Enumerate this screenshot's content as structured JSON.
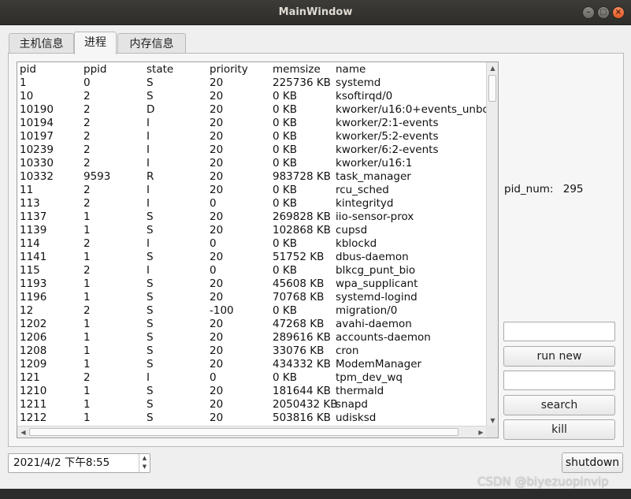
{
  "window": {
    "title": "MainWindow"
  },
  "tabs": [
    {
      "label": "主机信息"
    },
    {
      "label": "进程"
    },
    {
      "label": "内存信息"
    }
  ],
  "process_table": {
    "headers": [
      "pid",
      "ppid",
      "state",
      "priority",
      "memsize",
      "name"
    ],
    "rows": [
      [
        "1",
        "0",
        "S",
        "20",
        "225736 KB",
        "systemd"
      ],
      [
        "10",
        "2",
        "S",
        "20",
        "0 KB",
        "ksoftirqd/0"
      ],
      [
        "10190",
        "2",
        "D",
        "20",
        "0 KB",
        "kworker/u16:0+events_unbo"
      ],
      [
        "10194",
        "2",
        "I",
        "20",
        "0 KB",
        "kworker/2:1-events"
      ],
      [
        "10197",
        "2",
        "I",
        "20",
        "0 KB",
        "kworker/5:2-events"
      ],
      [
        "10239",
        "2",
        "I",
        "20",
        "0 KB",
        "kworker/6:2-events"
      ],
      [
        "10330",
        "2",
        "I",
        "20",
        "0 KB",
        "kworker/u16:1"
      ],
      [
        "10332",
        "9593",
        "R",
        "20",
        "983728 KB",
        "task_manager"
      ],
      [
        "11",
        "2",
        "I",
        "20",
        "0 KB",
        "rcu_sched"
      ],
      [
        "113",
        "2",
        "I",
        "0",
        "0 KB",
        "kintegrityd"
      ],
      [
        "1137",
        "1",
        "S",
        "20",
        "269828 KB",
        "iio-sensor-prox"
      ],
      [
        "1139",
        "1",
        "S",
        "20",
        "102868 KB",
        "cupsd"
      ],
      [
        "114",
        "2",
        "I",
        "0",
        "0 KB",
        "kblockd"
      ],
      [
        "1141",
        "1",
        "S",
        "20",
        "51752 KB",
        "dbus-daemon"
      ],
      [
        "115",
        "2",
        "I",
        "0",
        "0 KB",
        "blkcg_punt_bio"
      ],
      [
        "1193",
        "1",
        "S",
        "20",
        "45608 KB",
        "wpa_supplicant"
      ],
      [
        "1196",
        "1",
        "S",
        "20",
        "70768 KB",
        "systemd-logind"
      ],
      [
        "12",
        "2",
        "S",
        "-100",
        "0 KB",
        "migration/0"
      ],
      [
        "1202",
        "1",
        "S",
        "20",
        "47268 KB",
        "avahi-daemon"
      ],
      [
        "1206",
        "1",
        "S",
        "20",
        "289616 KB",
        "accounts-daemon"
      ],
      [
        "1208",
        "1",
        "S",
        "20",
        "33076 KB",
        "cron"
      ],
      [
        "1209",
        "1",
        "S",
        "20",
        "434332 KB",
        "ModemManager"
      ],
      [
        "121",
        "2",
        "I",
        "0",
        "0 KB",
        "tpm_dev_wq"
      ],
      [
        "1210",
        "1",
        "S",
        "20",
        "181644 KB",
        "thermald"
      ],
      [
        "1211",
        "1",
        "S",
        "20",
        "2050432 KB",
        "snapd"
      ],
      [
        "1212",
        "1",
        "S",
        "20",
        "503816 KB",
        "udisksd"
      ]
    ]
  },
  "side": {
    "pid_num_label": "pid_num:",
    "pid_num_value": "295",
    "run_input_value": "",
    "run_button": "run new",
    "search_input_value": "",
    "search_button": "search",
    "kill_button": "kill"
  },
  "bottom": {
    "datetime": "2021/4/2 下午8:55",
    "shutdown_button": "shutdown"
  },
  "watermark": "CSDN @biyezuopinvip"
}
